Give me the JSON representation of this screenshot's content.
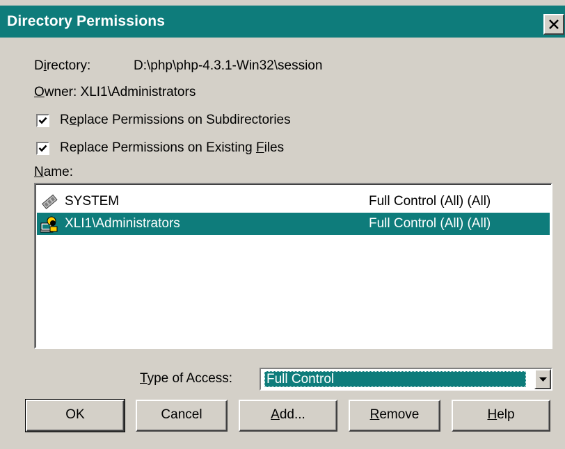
{
  "window": {
    "title": "Directory Permissions"
  },
  "directory": {
    "label": "Directory:",
    "value": "D:\\php\\php-4.3.1-Win32\\session"
  },
  "owner": {
    "label": "Owner:",
    "value": "XLI1\\Administrators"
  },
  "options": [
    {
      "label": "Replace Permissions on Subdirectories",
      "checked": true
    },
    {
      "label": "Replace Permissions on Existing Files",
      "checked": true
    }
  ],
  "name_list": {
    "label": "Name:",
    "rows": [
      {
        "name": "SYSTEM",
        "access": "Full Control (All) (All)",
        "icon": "computer-icon",
        "selected": false
      },
      {
        "name": "XLI1\\Administrators",
        "access": "Full Control (All) (All)",
        "icon": "group-icon",
        "selected": true
      }
    ]
  },
  "type_of_access": {
    "label": "Type of Access:",
    "value": "Full Control"
  },
  "buttons": {
    "ok": "OK",
    "cancel": "Cancel",
    "add": "Add...",
    "remove": "Remove",
    "help": "Help"
  },
  "colors": {
    "title_bar": "#0e7c7b",
    "selection": "#0e7c7b",
    "face": "#d4d0c8"
  }
}
